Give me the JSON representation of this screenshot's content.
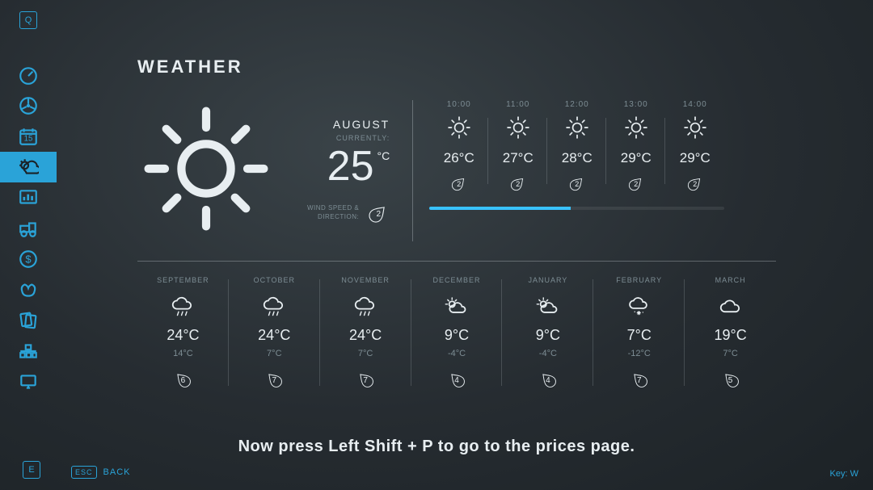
{
  "sidebar": {
    "top_key": "Q",
    "bottom_key": "E",
    "items": [
      {
        "name": "gauge-icon"
      },
      {
        "name": "steering-icon"
      },
      {
        "name": "calendar-icon",
        "badge": "15"
      },
      {
        "name": "weather-icon",
        "selected": true
      },
      {
        "name": "stats-icon"
      },
      {
        "name": "vehicle-icon"
      },
      {
        "name": "finance-icon"
      },
      {
        "name": "animals-icon"
      },
      {
        "name": "contracts-icon"
      },
      {
        "name": "production-icon"
      },
      {
        "name": "help-icon"
      }
    ]
  },
  "title": "WEATHER",
  "current": {
    "month": "AUGUST",
    "currently_label": "CURRENTLY:",
    "temp": "25",
    "unit": "°C",
    "wind_label": "WIND SPEED &\nDIRECTION:",
    "wind_value": "2"
  },
  "hourly": {
    "progress_pct": 48,
    "items": [
      {
        "time": "10:00",
        "temp": "26°C",
        "drop": "2"
      },
      {
        "time": "11:00",
        "temp": "27°C",
        "drop": "2"
      },
      {
        "time": "12:00",
        "temp": "28°C",
        "drop": "2"
      },
      {
        "time": "13:00",
        "temp": "29°C",
        "drop": "2"
      },
      {
        "time": "14:00",
        "temp": "29°C",
        "drop": "2"
      }
    ]
  },
  "monthly": [
    {
      "name": "SEPTEMBER",
      "icon": "rain",
      "hi": "24°C",
      "lo": "14°C",
      "drop": "6"
    },
    {
      "name": "OCTOBER",
      "icon": "rain",
      "hi": "24°C",
      "lo": "7°C",
      "drop": "7"
    },
    {
      "name": "NOVEMBER",
      "icon": "rain",
      "hi": "24°C",
      "lo": "7°C",
      "drop": "7"
    },
    {
      "name": "DECEMBER",
      "icon": "partly",
      "hi": "9°C",
      "lo": "-4°C",
      "drop": "4"
    },
    {
      "name": "JANUARY",
      "icon": "partly",
      "hi": "9°C",
      "lo": "-4°C",
      "drop": "4"
    },
    {
      "name": "FEBRUARY",
      "icon": "snow",
      "hi": "7°C",
      "lo": "-12°C",
      "drop": "7"
    },
    {
      "name": "MARCH",
      "icon": "cloud",
      "hi": "19°C",
      "lo": "7°C",
      "drop": "5"
    }
  ],
  "hint": "Now press Left Shift + P to go to the prices page.",
  "back": {
    "key": "ESC",
    "label": "BACK"
  },
  "bottom_right": "Key: W"
}
